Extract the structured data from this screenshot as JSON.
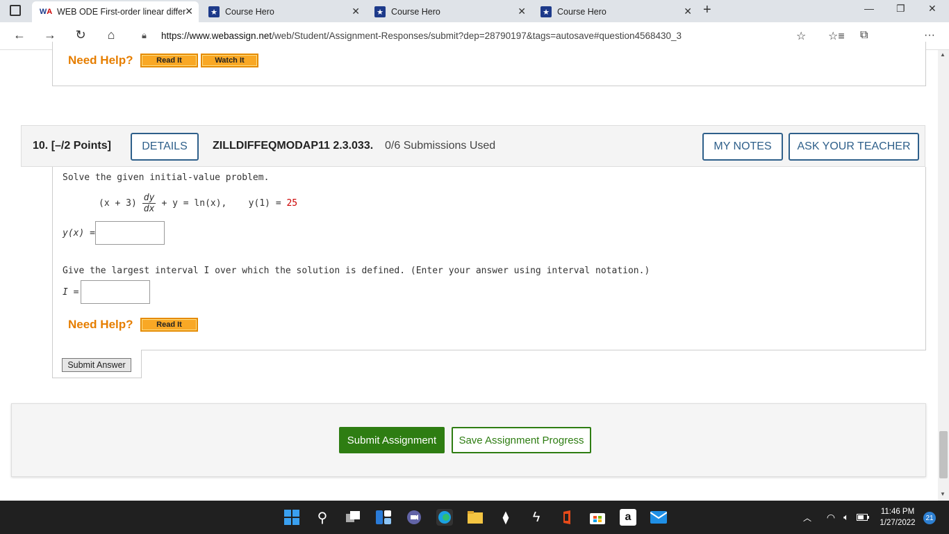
{
  "browser": {
    "tabs": [
      {
        "title": "WEB ODE First-order linear differ",
        "active": true,
        "favicon": "webassign-icon"
      },
      {
        "title": "Course Hero",
        "active": false,
        "favicon": "coursehero-icon"
      },
      {
        "title": "Course Hero",
        "active": false,
        "favicon": "coursehero-icon"
      },
      {
        "title": "Course Hero",
        "active": false,
        "favicon": "coursehero-icon"
      }
    ],
    "url_domain": "https://www.webassign.net",
    "url_path": "/web/Student/Assignment-Responses/submit?dep=28790197&tags=autosave#question4568430_3"
  },
  "prev_question": {
    "need_help": "Need Help?",
    "read_it": "Read It",
    "watch_it": "Watch It"
  },
  "question": {
    "number": "10.",
    "points": "[–/2 Points]",
    "details": "DETAILS",
    "code": "ZILLDIFFEQMODAP11 2.3.033.",
    "submissions": "0/6 Submissions Used",
    "my_notes": "MY NOTES",
    "ask_teacher": "ASK YOUR TEACHER",
    "prompt": "Solve the given initial-value problem.",
    "eq_left": "(x + 3)",
    "eq_num": "dy",
    "eq_den": "dx",
    "eq_right": "+ y = ln(x),    y(1) = ",
    "eq_value": "25",
    "answer_label": "y(x) =",
    "interval_prompt": "Give the largest interval I over which the solution is defined. (Enter your answer using interval notation.)",
    "interval_label": "I =",
    "need_help": "Need Help?",
    "read_it": "Read It",
    "submit_answer": "Submit Answer"
  },
  "footer": {
    "submit_assignment": "Submit Assignment",
    "save_progress": "Save Assignment Progress"
  },
  "taskbar": {
    "time": "11:46 PM",
    "date": "1/27/2022",
    "notifications": "21"
  },
  "colors": {
    "accent_blue": "#2e5f8a",
    "help_orange": "#e67e00",
    "submit_green": "#2e7d12",
    "value_red": "#cc0000"
  }
}
